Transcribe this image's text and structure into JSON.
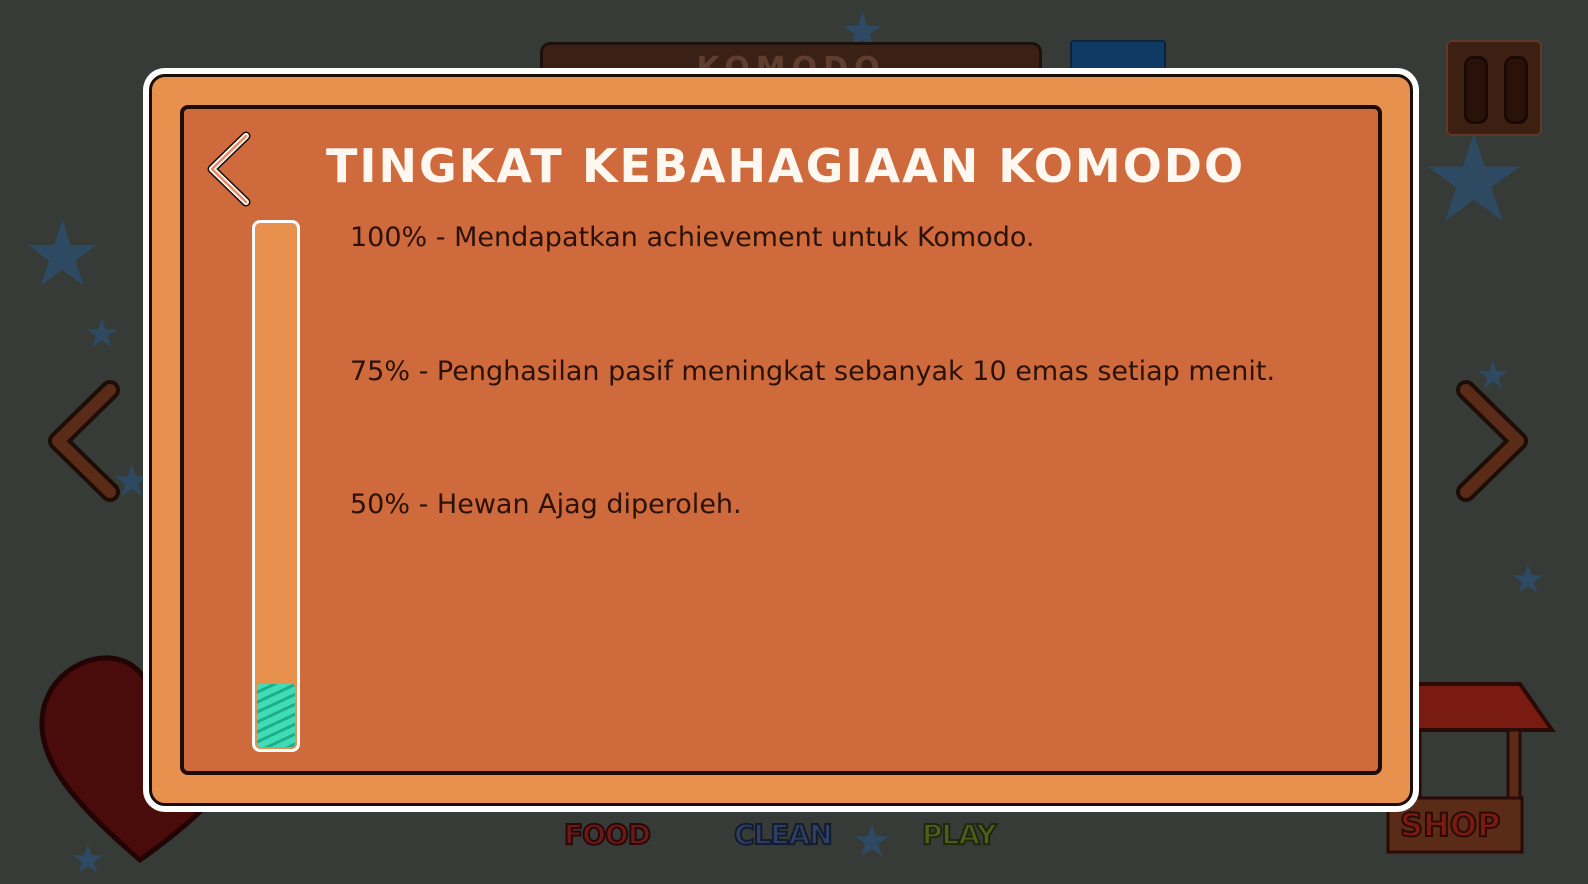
{
  "modal": {
    "title": "TINGKAT KEBAHAGIAAN KOMODO",
    "happiness_percent": 12,
    "levels": [
      "100% - Mendapatkan achievement untuk Komodo.",
      "75% - Penghasilan pasif meningkat sebanyak 10 emas setiap menit.",
      "50% - Hewan Ajag diperoleh."
    ]
  },
  "background": {
    "top_title": "KOMODO",
    "bottom_nav": [
      "FOOD",
      "CLEAN",
      "PLAY"
    ],
    "shop_label": "SHOP"
  },
  "icons": {
    "back": "chevron-left-icon",
    "pause": "pause-icon",
    "prev": "arrow-left-icon",
    "next": "arrow-right-icon",
    "heart": "heart-icon",
    "shop": "shop-stall-icon"
  },
  "colors": {
    "background": "#363b37",
    "modal_frame": "#e8914f",
    "modal_panel": "#cf6a3c",
    "meter_fill": "#3fdcb6"
  }
}
